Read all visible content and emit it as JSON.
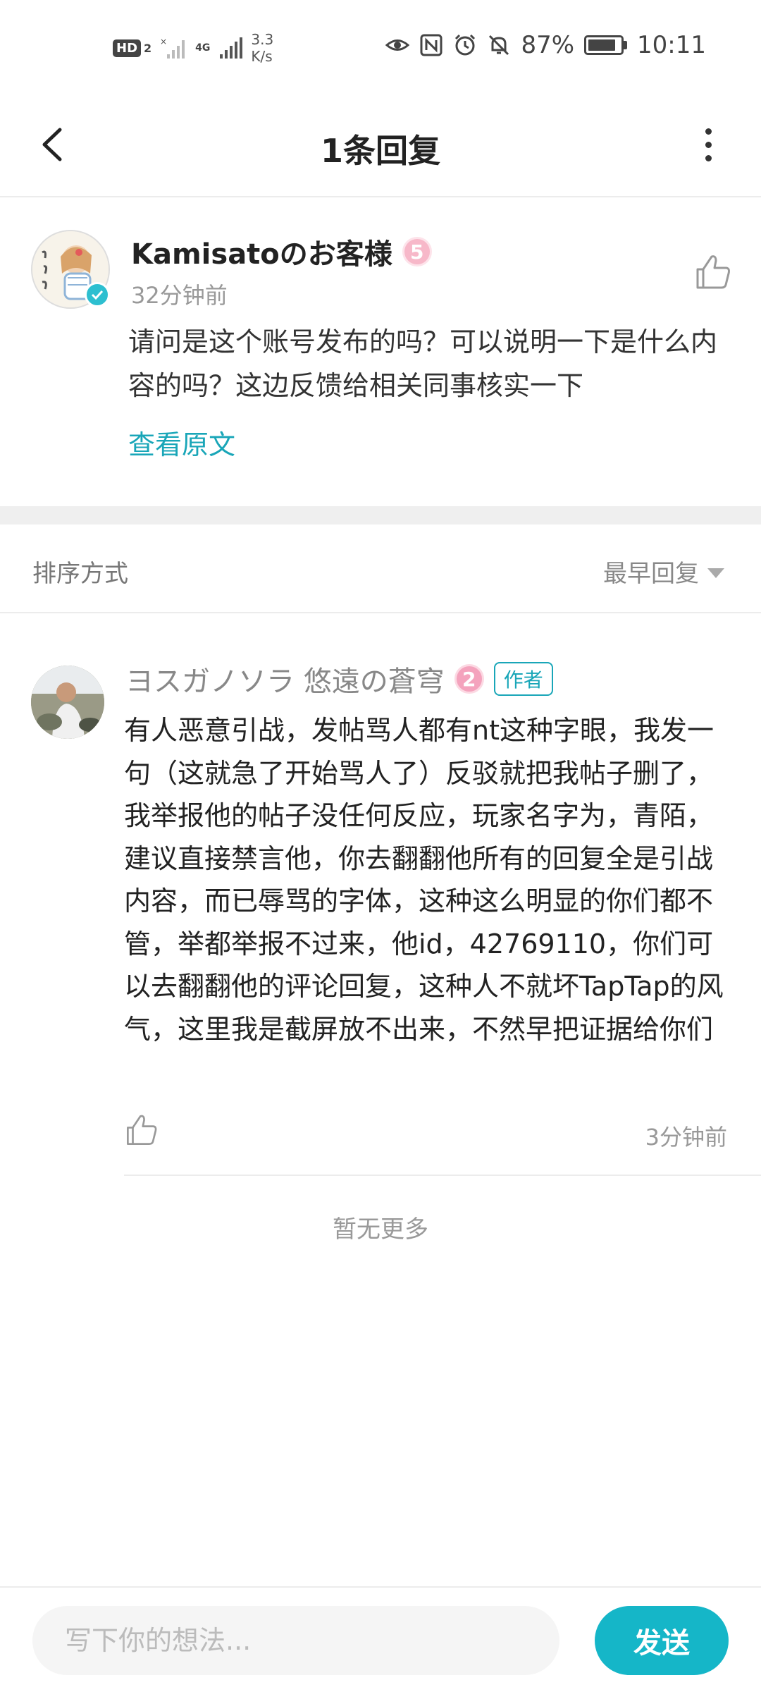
{
  "status_bar": {
    "hd_label": "HD",
    "hd_sub": "2",
    "network": "4G",
    "speed_value": "3.3",
    "speed_unit": "K/s",
    "battery": "87%",
    "battery_level": 0.87,
    "time": "10:11"
  },
  "header": {
    "title": "1条回复"
  },
  "original_comment": {
    "author": "Kamisatoのお客様",
    "level": "5",
    "time": "32分钟前",
    "text": "请问是这个账号发布的吗？可以说明一下是什么内容的吗？这边反馈给相关同事核实一下",
    "view_original": "查看原文"
  },
  "sort": {
    "label": "排序方式",
    "value": "最早回复"
  },
  "reply": {
    "author": "ヨスガノソラ 悠遠の蒼穹",
    "level": "2",
    "author_tag": "作者",
    "text": "有人恶意引战，发帖骂人都有nt这种字眼，我发一句（这就急了开始骂人了）反驳就把我帖子删了，我举报他的帖子没任何反应，玩家名字为，青陌，建议直接禁言他，你去翻翻他所有的回复全是引战内容，而已辱骂的字体，这种这么明显的你们都不管，举都举报不过来，他id，42769110，你们可以去翻翻他的评论回复，这种人不就坏TapTap的风气，这里我是截屏放不出来，不然早把证据给你们",
    "time": "3分钟前"
  },
  "no_more": "暂无更多",
  "composer": {
    "placeholder": "写下你的想法...",
    "send_label": "发送"
  },
  "colors": {
    "accent": "#15b6c8",
    "link": "#19a6b8",
    "level_badge": "#f7b8c9"
  }
}
